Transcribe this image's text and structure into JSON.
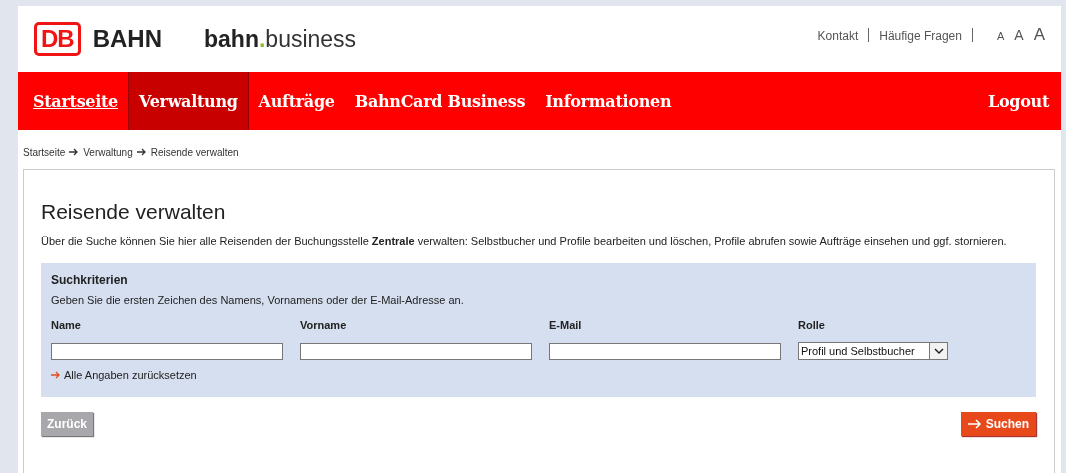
{
  "logo": {
    "badge": "DB",
    "name": "BAHN",
    "product_bold": "bahn",
    "product_dot": ".",
    "product_rest": "business"
  },
  "top_links": [
    "Kontakt",
    "Häufige Fragen"
  ],
  "font_sizes": [
    "A",
    "A",
    "A"
  ],
  "nav": {
    "items": [
      {
        "label": "Startseite",
        "selected": false,
        "underlined": true
      },
      {
        "label": "Verwaltung",
        "selected": true,
        "underlined": false
      },
      {
        "label": "Aufträge",
        "selected": false,
        "underlined": false
      },
      {
        "label": "BahnCard Business",
        "selected": false,
        "underlined": false
      },
      {
        "label": "Informationen",
        "selected": false,
        "underlined": false
      }
    ],
    "logout": "Logout"
  },
  "breadcrumb": [
    "Startseite",
    "Verwaltung",
    "Reisende verwalten"
  ],
  "title": "Reisende verwalten",
  "intro": "Über die Suche können Sie hier alle Reisenden der Buchungsstelle **Zentrale** verwalten: Selbstbucher und Profile bearbeiten und löschen, Profile abrufen sowie Aufträge einsehen und ggf. stornieren.",
  "search": {
    "heading": "Suchkriterien",
    "hint": "Geben Sie die ersten Zeichen des Namens, Vornamens oder der E-Mail-Adresse an.",
    "fields": [
      {
        "label": "Name",
        "kind": "text"
      },
      {
        "label": "Vorname",
        "kind": "text"
      },
      {
        "label": "E-Mail",
        "kind": "text"
      },
      {
        "label": "Rolle",
        "kind": "select",
        "value": "Profil und Selbstbucher"
      }
    ],
    "reset_link": "Alle Angaben zurücksetzen"
  },
  "buttons": {
    "back": "Zurück",
    "search": "Suchen"
  }
}
